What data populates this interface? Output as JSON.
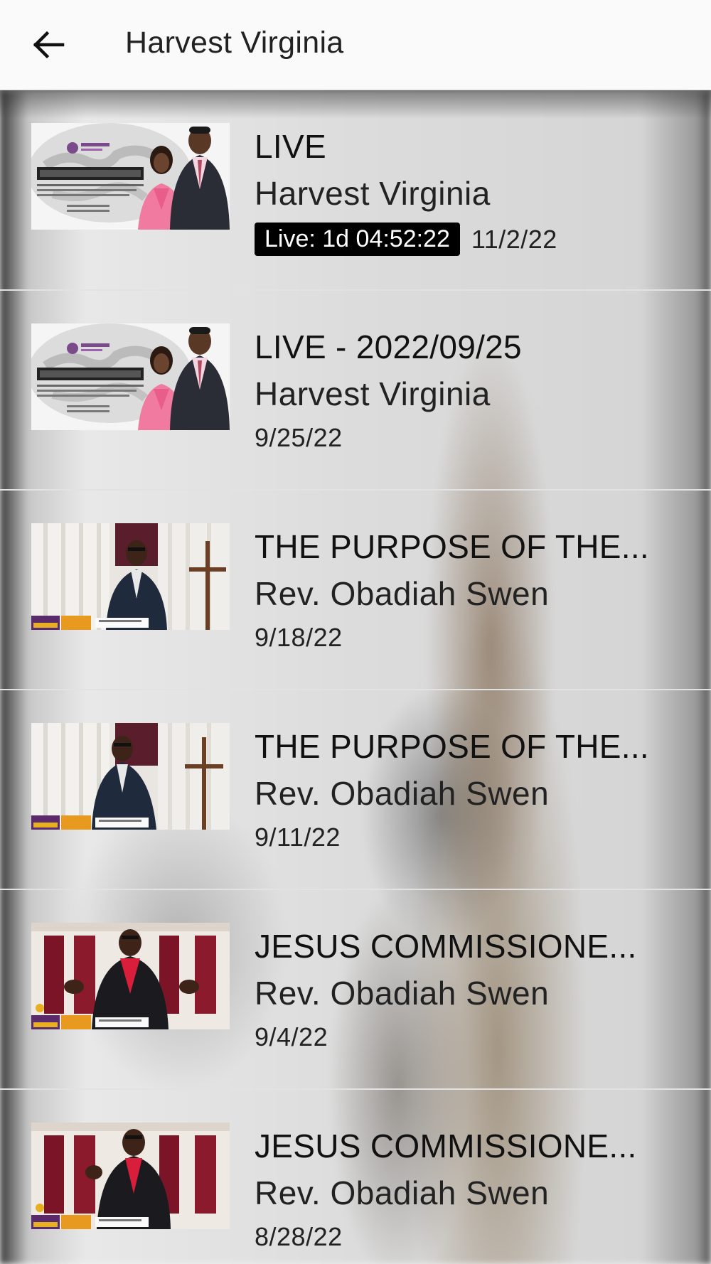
{
  "app_bar": {
    "title": "Harvest Virginia",
    "back_icon": "arrow-left-icon"
  },
  "colors": {
    "app_bar_bg": "#fafafa",
    "live_badge_bg": "#000000",
    "live_badge_text": "#ffffff",
    "divider": "#e2e2e2"
  },
  "items": [
    {
      "title": "LIVE",
      "author": "Harvest Virginia",
      "live_label": "Live: 1d 04:52:22",
      "date": "11/2/22",
      "thumbnail": "transforming-lives-couple-thumbnail"
    },
    {
      "title": "LIVE - 2022/09/25",
      "author": "Harvest Virginia",
      "date": "9/25/22",
      "thumbnail": "transforming-lives-couple-thumbnail"
    },
    {
      "title": "THE PURPOSE OF THE...",
      "author": "Rev. Obadiah Swen",
      "date": "9/18/22",
      "thumbnail": "preacher-with-cross-thumbnail"
    },
    {
      "title": "THE PURPOSE OF THE...",
      "author": "Rev. Obadiah Swen",
      "date": "9/11/22",
      "thumbnail": "preacher-with-cross-thumbnail"
    },
    {
      "title": "JESUS COMMISSIONE...",
      "author": "Rev. Obadiah Swen",
      "date": "9/4/22",
      "thumbnail": "preacher-red-curtains-thumbnail"
    },
    {
      "title": "JESUS COMMISSIONE...",
      "author": "Rev. Obadiah Swen",
      "date": "8/28/22",
      "thumbnail": "preacher-red-curtains-thumbnail"
    }
  ]
}
